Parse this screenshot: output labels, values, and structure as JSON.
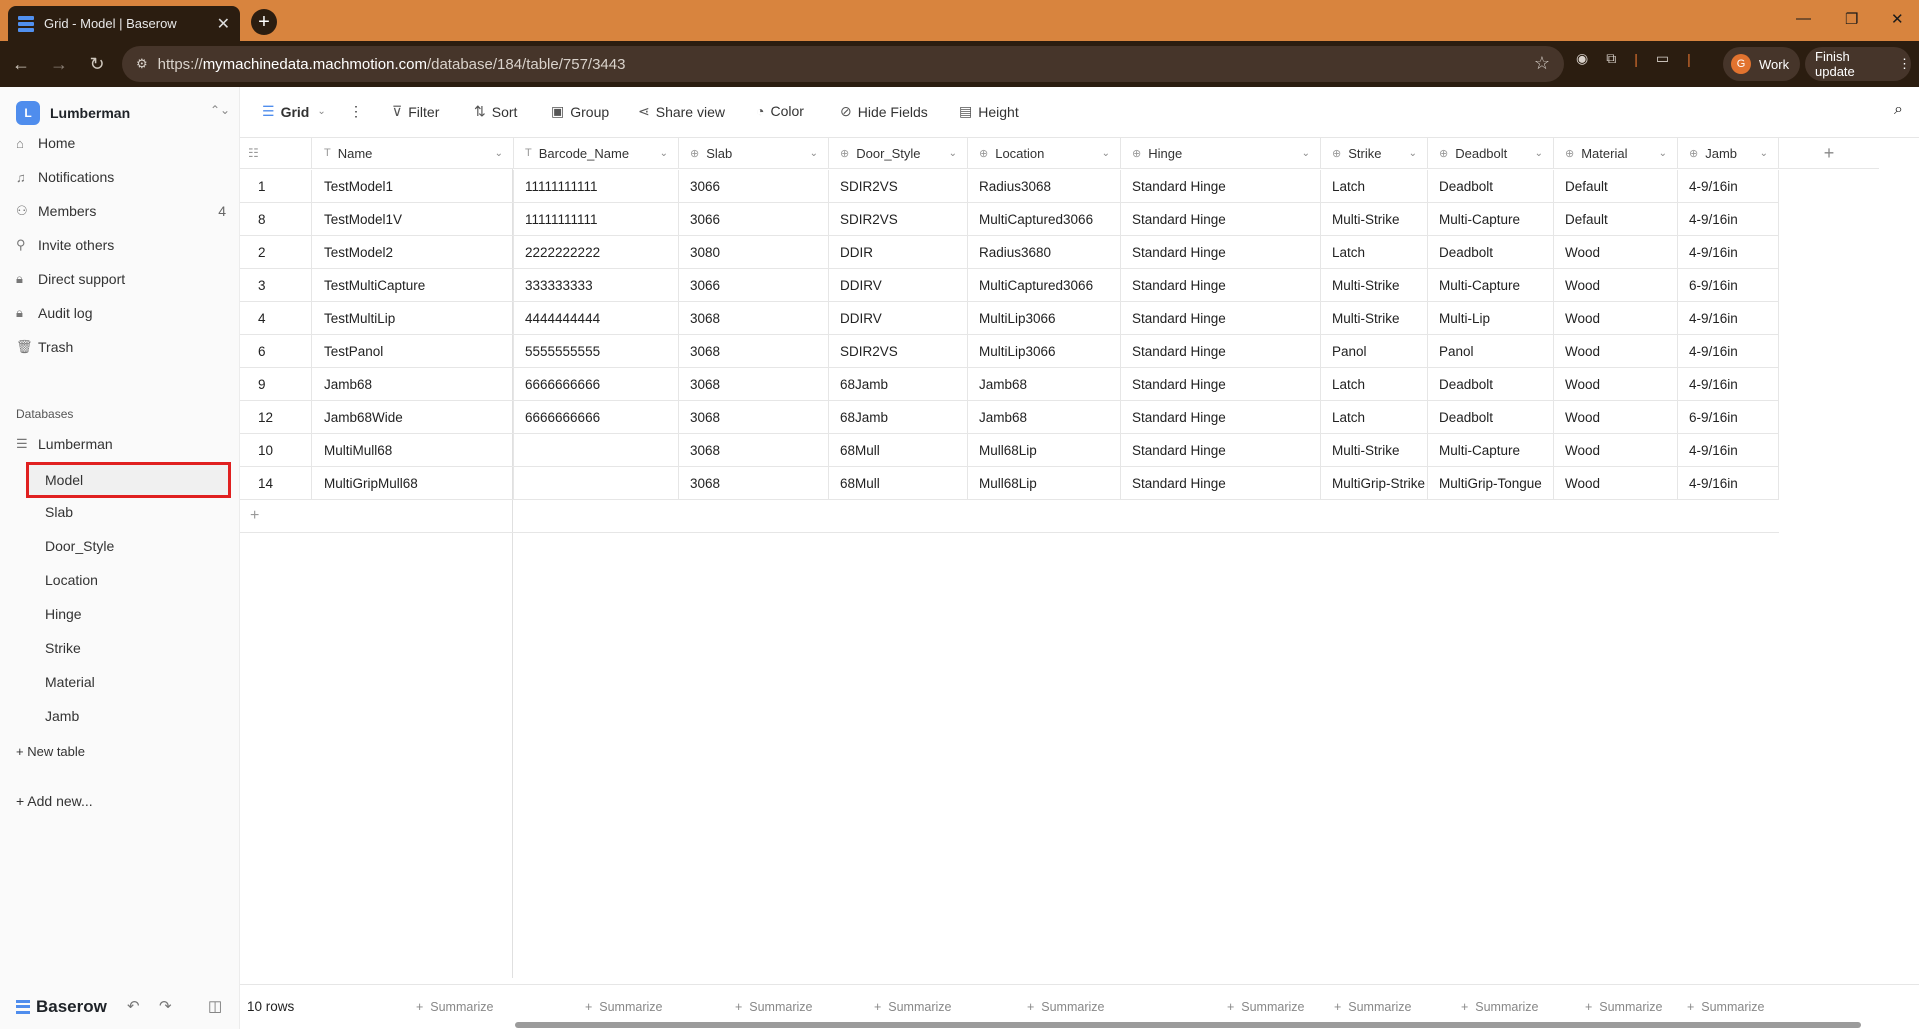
{
  "browser": {
    "tab_title": "Grid - Model | Baserow",
    "url_prefix": "https://",
    "url_host": "mymachinedata.machmotion.com",
    "url_path": "/database/184/table/757/3443",
    "profile_initial": "G",
    "profile_label": "Work",
    "finish_update": "Finish update"
  },
  "sidebar": {
    "workspace_initial": "L",
    "workspace_name": "Lumberman",
    "nav": [
      {
        "label": "Home",
        "icon": "home-icon"
      },
      {
        "label": "Notifications",
        "icon": "bell-icon"
      },
      {
        "label": "Members",
        "icon": "members-icon",
        "count": "4"
      },
      {
        "label": "Invite others",
        "icon": "invite-icon"
      },
      {
        "label": "Direct support",
        "icon": "lock-icon"
      },
      {
        "label": "Audit log",
        "icon": "lock-icon"
      },
      {
        "label": "Trash",
        "icon": "trash-icon"
      }
    ],
    "databases_heading": "Databases",
    "database_name": "Lumberman",
    "tables": [
      "Model",
      "Slab",
      "Door_Style",
      "Location",
      "Hinge",
      "Strike",
      "Material",
      "Jamb"
    ],
    "selected_table": "Model",
    "new_table": "+ New table",
    "add_new": "+ Add new...",
    "brand": "Baserow"
  },
  "view_toolbar": {
    "view_name": "Grid",
    "filter": "Filter",
    "sort": "Sort",
    "group": "Group",
    "share_view": "Share view",
    "color": "Color",
    "hide_fields": "Hide Fields",
    "height": "Height"
  },
  "grid": {
    "columns": [
      "Name",
      "Barcode_Name",
      "Slab",
      "Door_Style",
      "Location",
      "Hinge",
      "Strike",
      "Deadbolt",
      "Material",
      "Jamb"
    ],
    "rows": [
      {
        "id": "1",
        "cells": [
          "TestModel1",
          "11111111111",
          "3066",
          "SDIR2VS",
          "Radius3068",
          "Standard Hinge",
          "Latch",
          "Deadbolt",
          "Default",
          "4-9/16in"
        ]
      },
      {
        "id": "8",
        "cells": [
          "TestModel1V",
          "11111111111",
          "3066",
          "SDIR2VS",
          "MultiCaptured3066",
          "Standard Hinge",
          "Multi-Strike",
          "Multi-Capture",
          "Default",
          "4-9/16in"
        ]
      },
      {
        "id": "2",
        "cells": [
          "TestModel2",
          "2222222222",
          "3080",
          "DDIR",
          "Radius3680",
          "Standard Hinge",
          "Latch",
          "Deadbolt",
          "Wood",
          "4-9/16in"
        ]
      },
      {
        "id": "3",
        "cells": [
          "TestMultiCapture",
          "333333333",
          "3066",
          "DDIRV",
          "MultiCaptured3066",
          "Standard Hinge",
          "Multi-Strike",
          "Multi-Capture",
          "Wood",
          "6-9/16in"
        ]
      },
      {
        "id": "4",
        "cells": [
          "TestMultiLip",
          "4444444444",
          "3068",
          "DDIRV",
          "MultiLip3066",
          "Standard Hinge",
          "Multi-Strike",
          "Multi-Lip",
          "Wood",
          "4-9/16in"
        ]
      },
      {
        "id": "6",
        "cells": [
          "TestPanol",
          "5555555555",
          "3068",
          "SDIR2VS",
          "MultiLip3066",
          "Standard Hinge",
          "Panol",
          "Panol",
          "Wood",
          "4-9/16in"
        ]
      },
      {
        "id": "9",
        "cells": [
          "Jamb68",
          "6666666666",
          "3068",
          "68Jamb",
          "Jamb68",
          "Standard Hinge",
          "Latch",
          "Deadbolt",
          "Wood",
          "4-9/16in"
        ]
      },
      {
        "id": "12",
        "cells": [
          "Jamb68Wide",
          "6666666666",
          "3068",
          "68Jamb",
          "Jamb68",
          "Standard Hinge",
          "Latch",
          "Deadbolt",
          "Wood",
          "6-9/16in"
        ]
      },
      {
        "id": "10",
        "cells": [
          "MultiMull68",
          "",
          "3068",
          "68Mull",
          "Mull68Lip",
          "Standard Hinge",
          "Multi-Strike",
          "Multi-Capture",
          "Wood",
          "4-9/16in"
        ]
      },
      {
        "id": "14",
        "cells": [
          "MultiGripMull68",
          "",
          "3068",
          "68Mull",
          "Mull68Lip",
          "Standard Hinge",
          "MultiGrip-Strike",
          "MultiGrip-Tongue",
          "Wood",
          "4-9/16in"
        ]
      }
    ],
    "row_count": "10 rows",
    "summarize": "Summarize"
  }
}
